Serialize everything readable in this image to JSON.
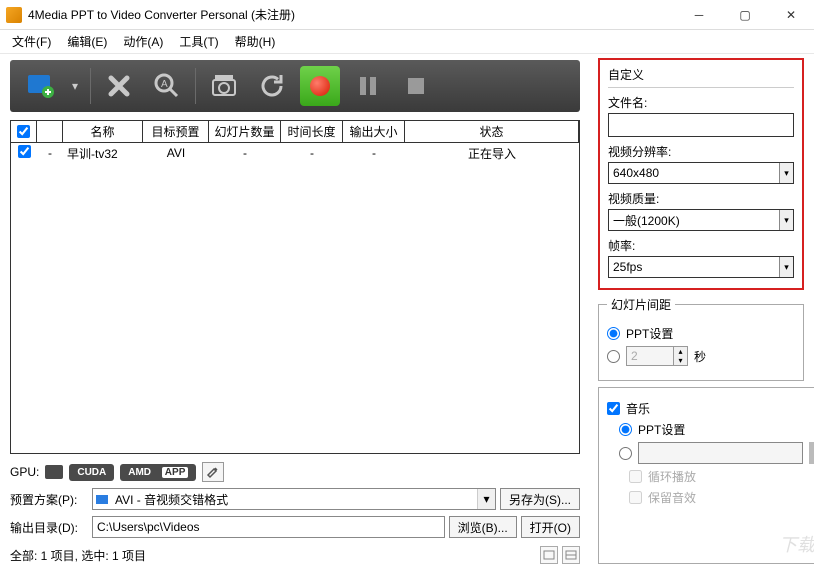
{
  "window": {
    "title": "4Media PPT to Video Converter Personal (未注册)"
  },
  "menu": {
    "file": "文件(F)",
    "edit": "编辑(E)",
    "action": "动作(A)",
    "tool": "工具(T)",
    "help": "帮助(H)"
  },
  "grid": {
    "headers": {
      "name": "名称",
      "preset": "目标预置",
      "slides": "幻灯片数量",
      "duration": "时间长度",
      "size": "输出大小",
      "status": "状态"
    },
    "rows": [
      {
        "checked": true,
        "name": "早训-tv32",
        "preset": "AVI",
        "slides": "-",
        "duration": "-",
        "size": "-",
        "status": "正在导入"
      }
    ]
  },
  "gpu": {
    "label": "GPU:",
    "cuda": "CUDA",
    "amd": "AMD",
    "app": "APP"
  },
  "preset": {
    "label": "预置方案(P):",
    "value": "AVI - 音视频交错格式",
    "saveAs": "另存为(S)..."
  },
  "output": {
    "label": "输出目录(D):",
    "value": "C:\\Users\\pc\\Videos",
    "browse": "浏览(B)...",
    "open": "打开(O)"
  },
  "statusbar": "全部: 1 项目, 选中: 1 项目",
  "custom": {
    "title": "自定义",
    "fileNameLabel": "文件名:",
    "fileName": "",
    "resolutionLabel": "视频分辨率:",
    "resolution": "640x480",
    "qualityLabel": "视频质量:",
    "quality": "一般(1200K)",
    "fpsLabel": "帧率:",
    "fps": "25fps"
  },
  "interval": {
    "legend": "幻灯片间距",
    "pptOption": "PPT设置",
    "customValue": "2",
    "unit": "秒"
  },
  "music": {
    "enableLabel": "音乐",
    "pptOption": "PPT设置",
    "loopLabel": "循环播放",
    "keepAudioLabel": "保留音效"
  },
  "watermark": "下载吧"
}
